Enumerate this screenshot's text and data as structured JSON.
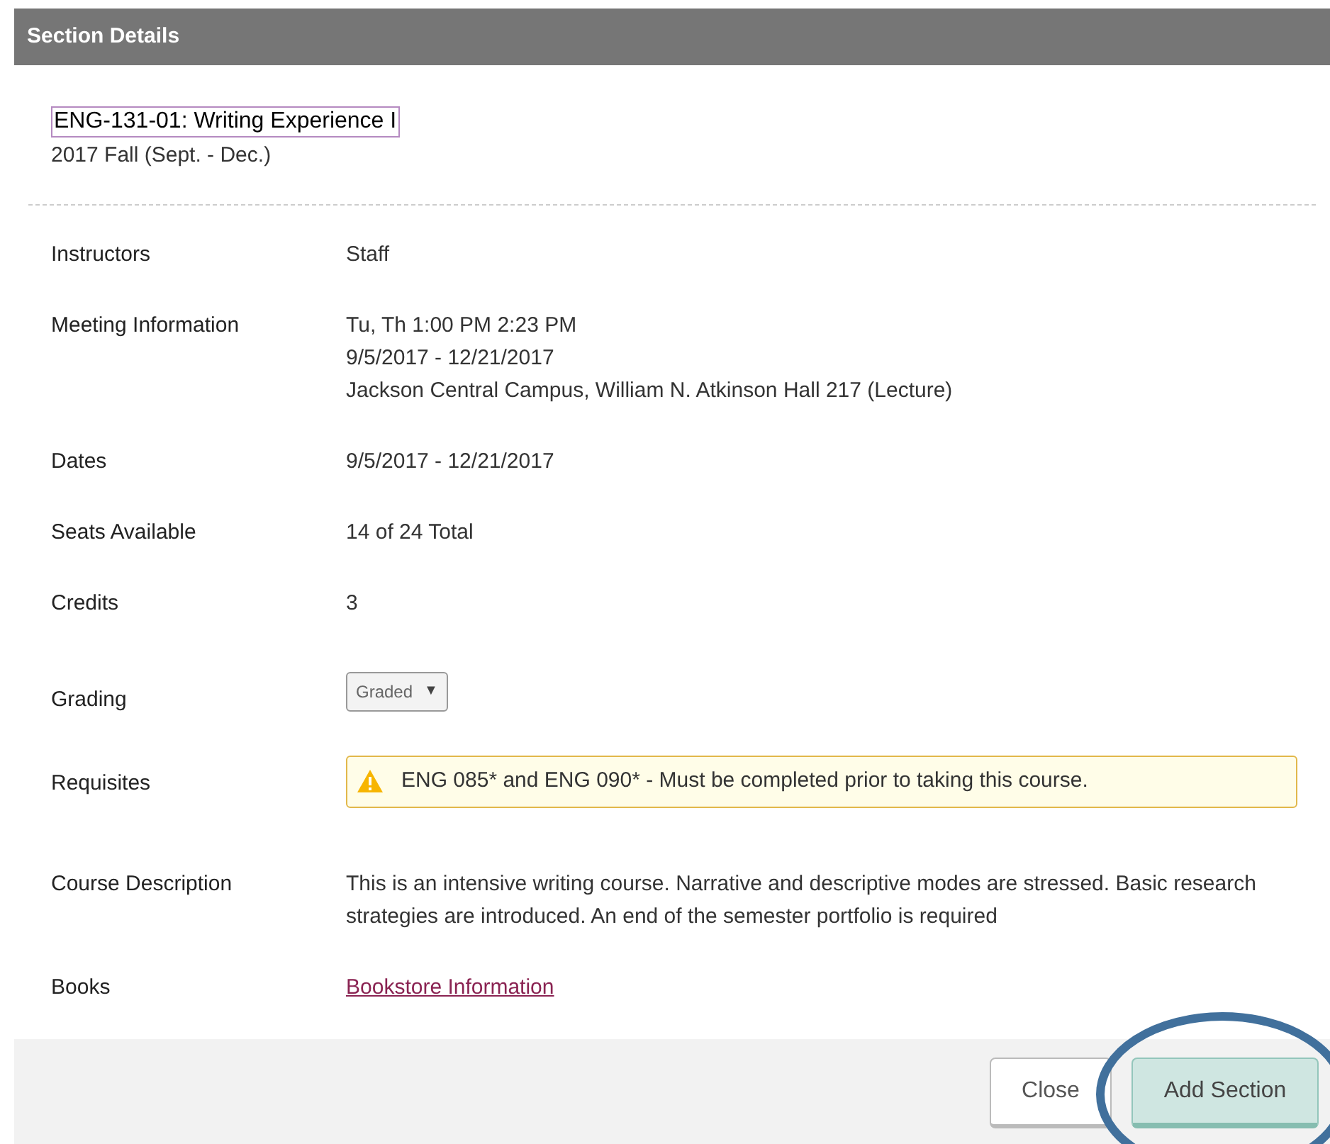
{
  "header": {
    "title": "Section Details"
  },
  "section": {
    "title": "ENG-131-01: Writing Experience I",
    "term": "2017 Fall (Sept. - Dec.)"
  },
  "rows": [
    {
      "label": "Instructors",
      "kind": "text",
      "lines": [
        "Staff"
      ]
    },
    {
      "label": "Meeting Information",
      "kind": "text",
      "lines": [
        "Tu, Th 1:00 PM 2:23 PM",
        "9/5/2017 - 12/21/2017",
        "Jackson Central Campus, William N. Atkinson Hall 217 (Lecture)"
      ]
    },
    {
      "label": "Dates",
      "kind": "text",
      "lines": [
        "9/5/2017 - 12/21/2017"
      ]
    },
    {
      "label": "Seats Available",
      "kind": "text",
      "lines": [
        "14 of 24 Total"
      ]
    },
    {
      "label": "Credits",
      "kind": "text",
      "lines": [
        "3"
      ]
    },
    {
      "label": "Grading",
      "kind": "select",
      "value": "Graded",
      "arrow": "▼"
    },
    {
      "label": "Requisites",
      "kind": "alert",
      "text": "ENG 085* and ENG 090* - Must be completed prior to taking this course."
    },
    {
      "label": "Course Description",
      "kind": "paragraph",
      "text": "This is an intensive writing course. Narrative and descriptive modes are stressed. Basic research strategies are introduced. An end of the semester portfolio is required"
    },
    {
      "label": "Books",
      "kind": "link",
      "text": "Bookstore Information"
    }
  ],
  "footer": {
    "buttons": [
      {
        "label": "Close",
        "kind": "secondary"
      },
      {
        "label": "Add Section",
        "kind": "primary"
      }
    ]
  }
}
